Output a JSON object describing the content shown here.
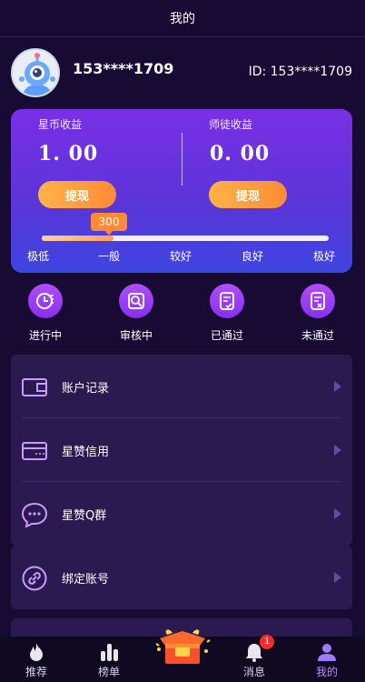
{
  "header": {
    "title": "我的"
  },
  "profile": {
    "username": "153****1709",
    "id_text": "ID: 153****1709"
  },
  "earnings": {
    "left": {
      "label": "星币收益",
      "value": "1. 00",
      "button": "提现"
    },
    "right": {
      "label": "师徒收益",
      "value": "0. 00",
      "button": "提现"
    }
  },
  "credit": {
    "score": "300",
    "level_fraction": 0.25,
    "levels": [
      "极低",
      "一般",
      "较好",
      "良好",
      "极好"
    ]
  },
  "status": [
    {
      "label": "进行中",
      "icon": "in-progress-icon"
    },
    {
      "label": "审核中",
      "icon": "reviewing-icon"
    },
    {
      "label": "已通过",
      "icon": "approved-icon"
    },
    {
      "label": "未通过",
      "icon": "rejected-icon"
    }
  ],
  "menu": [
    {
      "label": "账户记录",
      "icon": "wallet-icon"
    },
    {
      "label": "星赞信用",
      "icon": "card-icon"
    },
    {
      "label": "星赞Q群",
      "icon": "chat-icon"
    },
    {
      "label": "绑定账号",
      "icon": "link-icon"
    }
  ],
  "nav": [
    {
      "label": "推荐",
      "icon": "flame-icon"
    },
    {
      "label": "榜单",
      "icon": "chart-icon"
    },
    {
      "label": "",
      "icon": "gift-box-icon"
    },
    {
      "label": "消息",
      "icon": "bell-icon",
      "badge": "1"
    },
    {
      "label": "我的",
      "icon": "user-icon"
    }
  ],
  "colors": {
    "accent": "#8a2ff0",
    "orange": "#ff8b36",
    "background": "#170b34"
  }
}
